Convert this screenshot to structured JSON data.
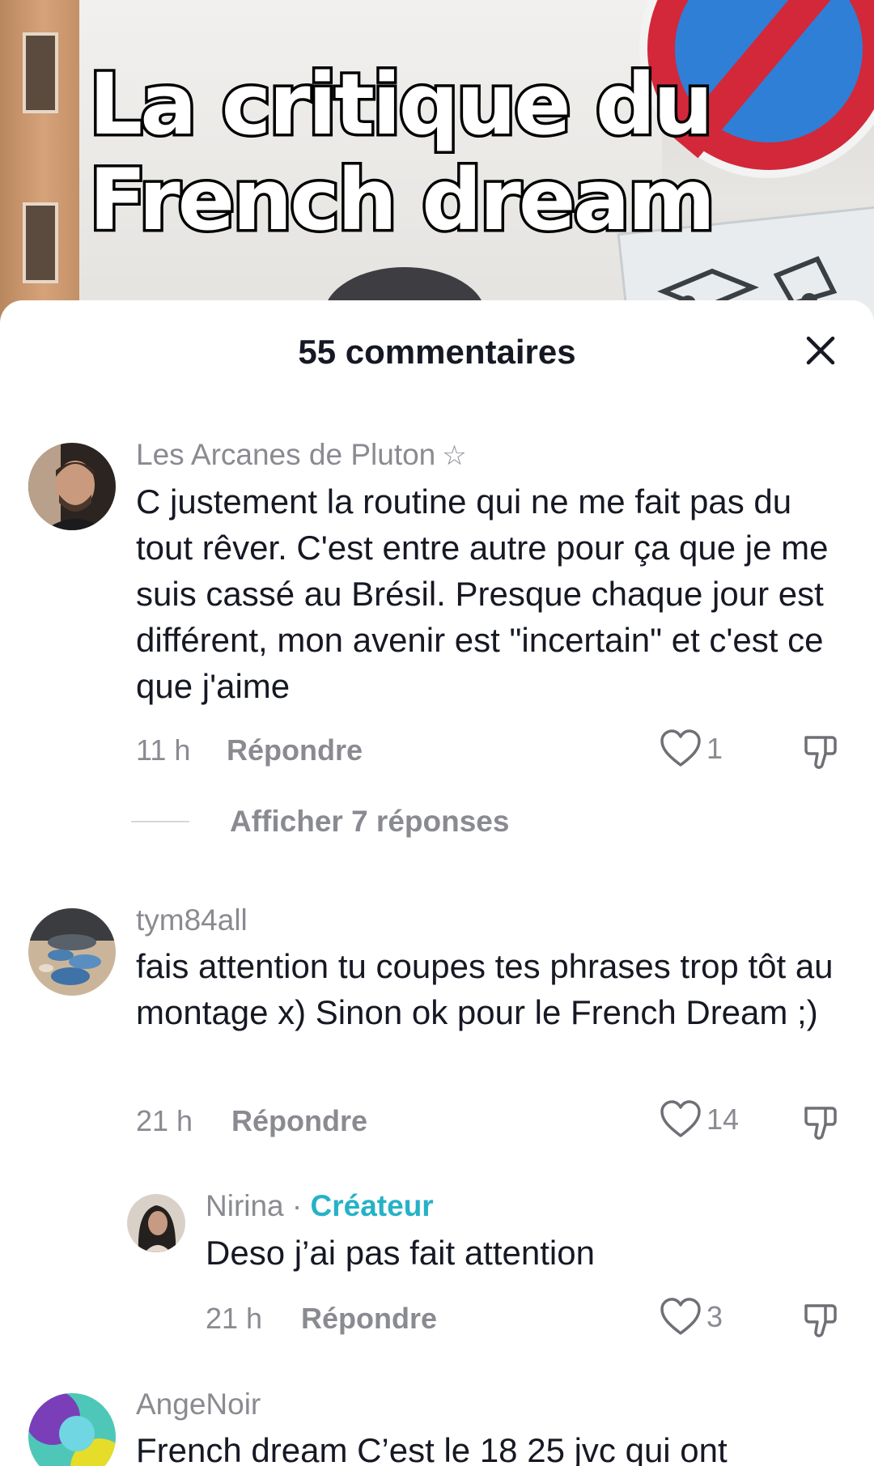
{
  "video": {
    "title_line1": "La critique du",
    "title_line2": "French dream"
  },
  "sheet": {
    "title": "55 commentaires",
    "close_icon": "close-icon"
  },
  "colors": {
    "text_primary": "#161823",
    "text_secondary": "#8a8b91",
    "creator_accent": "#25b2c7"
  },
  "comments": [
    {
      "username": "Les Arcanes de Pluton",
      "badge": "☆",
      "text": "C justement la routine qui ne me fait pas du tout rêver. C'est entre autre pour ça que je me suis cassé au Brésil. Presque chaque jour est différent, mon avenir est \"incertain\" et c'est ce que j'aime",
      "time": "11 h",
      "reply_label": "Répondre",
      "likes": "1",
      "show_replies": "Afficher 7 réponses"
    },
    {
      "username": "tym84all",
      "text": "fais attention tu coupes tes phrases trop tôt au montage x) Sinon ok pour le French Dream ;)",
      "time": "21 h",
      "reply_label": "Répondre",
      "likes": "14",
      "reply": {
        "username": "Nirina",
        "separator": "·",
        "creator_label": "Créateur",
        "text": "Deso j’ai pas fait attention",
        "time": "21 h",
        "reply_label": "Répondre",
        "likes": "3"
      }
    },
    {
      "username": "AngeNoir",
      "text": "French dream C’est le 18 25 jvc qui ont"
    }
  ]
}
